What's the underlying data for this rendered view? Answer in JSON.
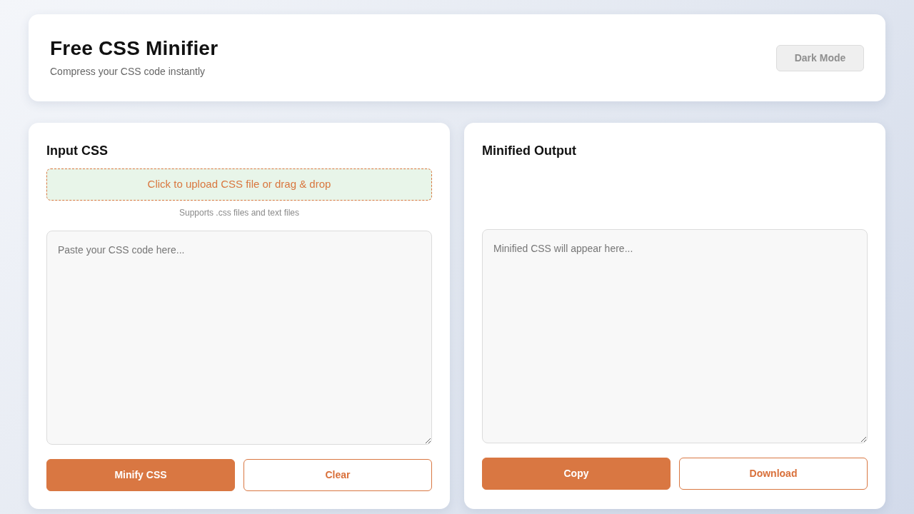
{
  "header": {
    "title": "Free CSS Minifier",
    "subtitle": "Compress your CSS code instantly",
    "theme_button": {
      "label": "Dark Mode",
      "disabled": true
    }
  },
  "panels": [
    {
      "title": "Input CSS",
      "upload": {
        "label": "Click to upload CSS file or drag & drop",
        "hint": "Supports .css files and text files"
      },
      "editor": {
        "placeholder": "Paste your CSS code here..."
      },
      "buttons": [
        {
          "label": "Minify CSS",
          "kind": "primary"
        },
        {
          "label": "Clear",
          "kind": "outline"
        }
      ]
    },
    {
      "title": "Minified Output",
      "editor": {
        "placeholder": "Minified CSS will appear here..."
      },
      "buttons": [
        {
          "label": "Copy",
          "kind": "primary"
        },
        {
          "label": "Download",
          "kind": "outline"
        }
      ]
    }
  ]
}
